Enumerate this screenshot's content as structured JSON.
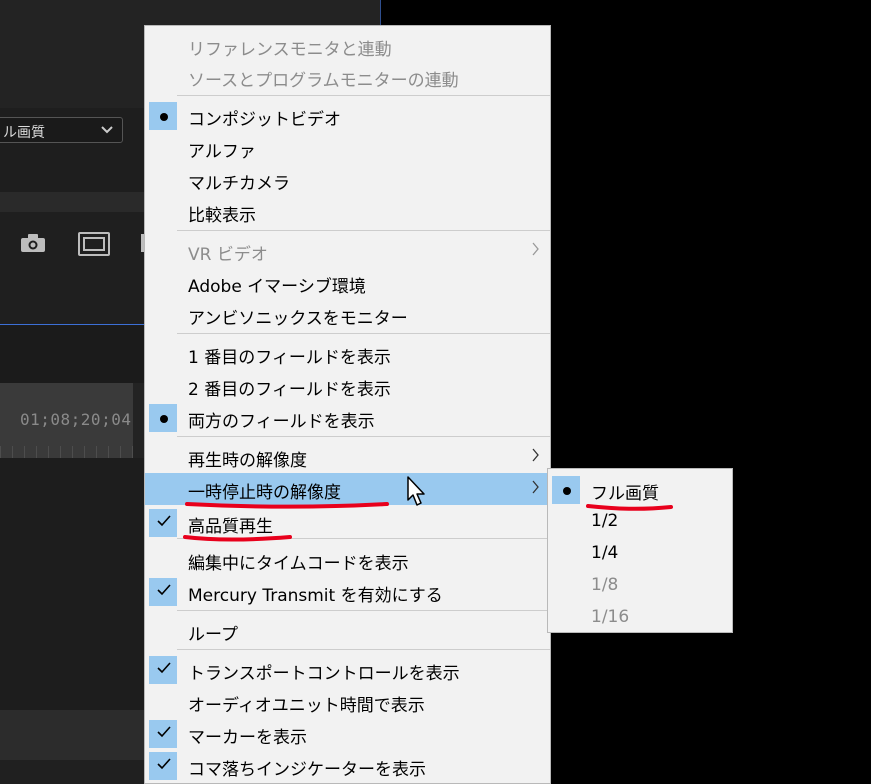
{
  "background": {
    "quality_selector": "ル画質",
    "timecode": "01;08;20;04"
  },
  "menu": {
    "items": [
      {
        "label": "リファレンスモニタと連動",
        "disabled": true
      },
      {
        "label": "ソースとプログラムモニターの連動",
        "disabled": true
      },
      {
        "label": "コンポジットビデオ",
        "mark": "dot"
      },
      {
        "label": "アルファ"
      },
      {
        "label": "マルチカメラ"
      },
      {
        "label": "比較表示"
      },
      {
        "label": "VR ビデオ",
        "disabled": true,
        "submenu": true
      },
      {
        "label": "Adobe イマーシブ環境"
      },
      {
        "label": "アンビソニックスをモニター"
      },
      {
        "label": "1 番目のフィールドを表示"
      },
      {
        "label": "2 番目のフィールドを表示"
      },
      {
        "label": "両方のフィールドを表示",
        "mark": "dot"
      },
      {
        "label": "再生時の解像度",
        "submenu": true
      },
      {
        "label": "一時停止時の解像度",
        "submenu": true,
        "highlighted": true
      },
      {
        "label": "高品質再生",
        "mark": "check"
      },
      {
        "label": "編集中にタイムコードを表示"
      },
      {
        "label": "Mercury Transmit を有効にする",
        "mark": "check"
      },
      {
        "label": "ループ"
      },
      {
        "label": "トランスポートコントロールを表示",
        "mark": "check"
      },
      {
        "label": "オーディオユニット時間で表示"
      },
      {
        "label": "マーカーを表示",
        "mark": "check"
      },
      {
        "label": "コマ落ちインジケーターを表示",
        "mark": "check"
      }
    ]
  },
  "submenu": {
    "items": [
      {
        "label": "フル画質",
        "mark": "dot"
      },
      {
        "label": "1/2"
      },
      {
        "label": "1/4"
      },
      {
        "label": "1/8",
        "disabled": true
      },
      {
        "label": "1/16",
        "disabled": true
      }
    ]
  },
  "colors": {
    "highlight": "#99c9ef",
    "menu_bg": "#f2f2f2",
    "annotation": "#e8001c"
  }
}
